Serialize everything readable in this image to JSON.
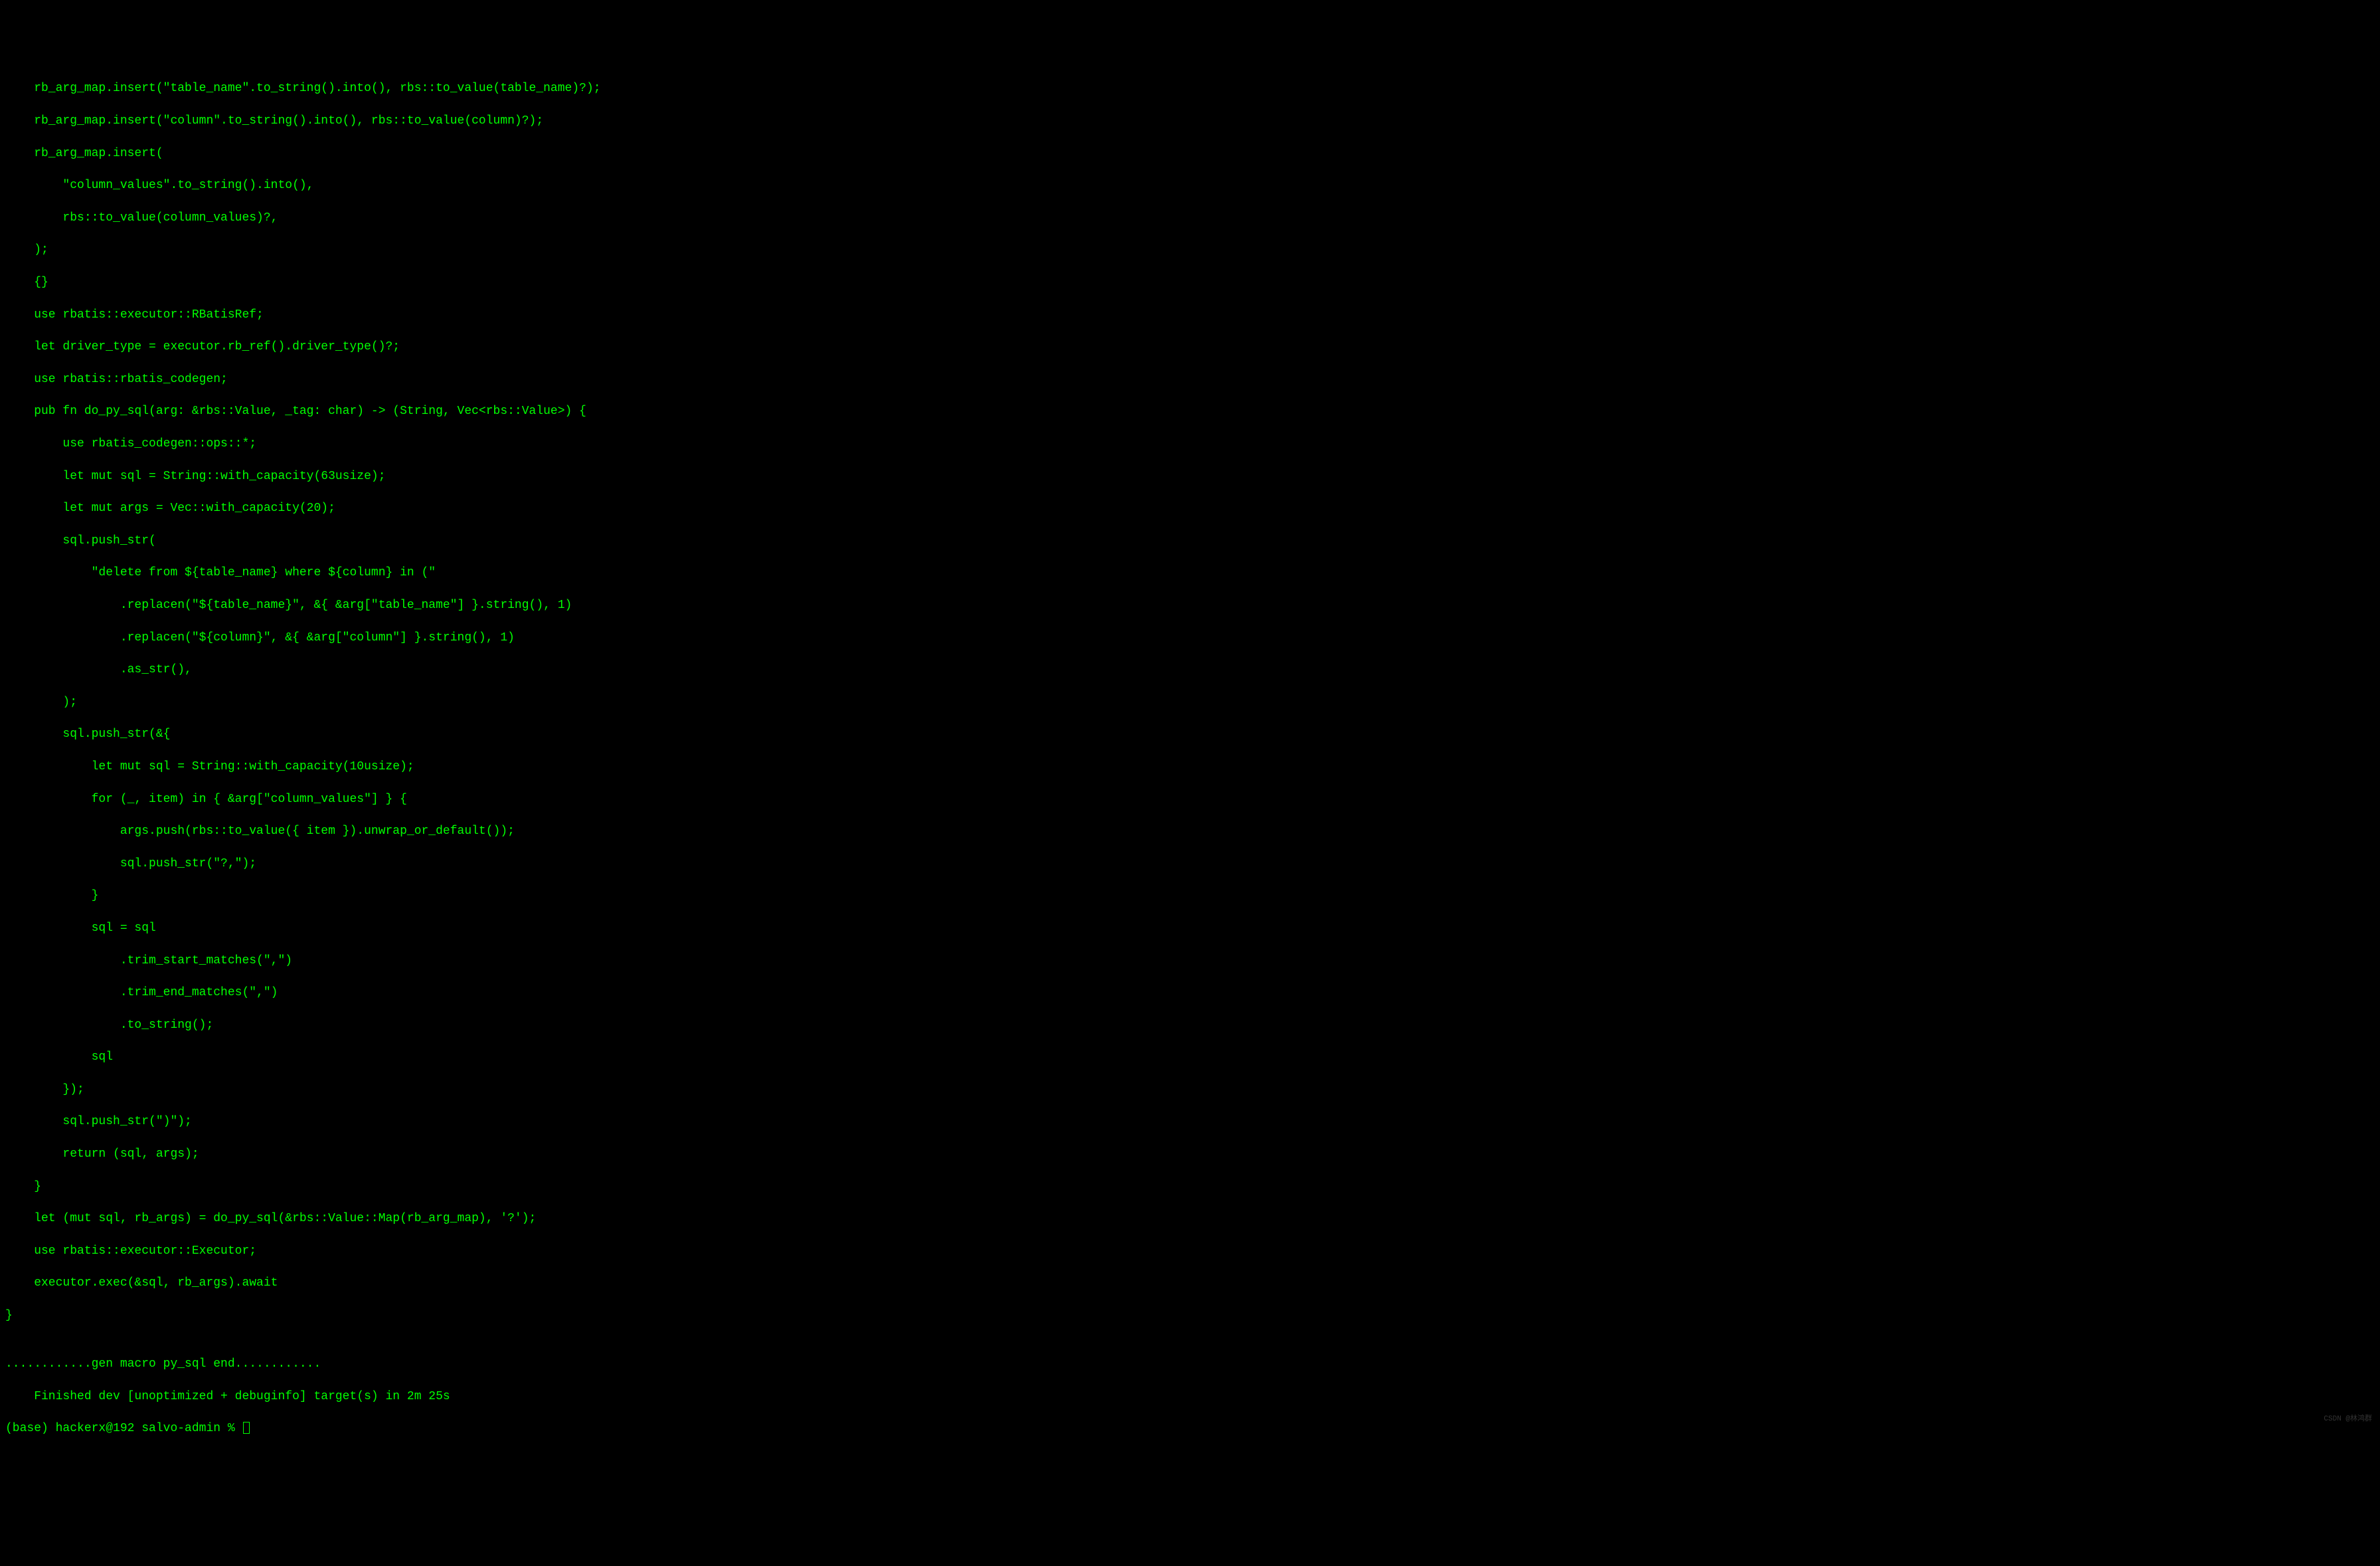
{
  "terminal": {
    "lines": [
      "    rb_arg_map.insert(\"table_name\".to_string().into(), rbs::to_value(table_name)?);",
      "    rb_arg_map.insert(\"column\".to_string().into(), rbs::to_value(column)?);",
      "    rb_arg_map.insert(",
      "        \"column_values\".to_string().into(),",
      "        rbs::to_value(column_values)?,",
      "    );",
      "    {}",
      "    use rbatis::executor::RBatisRef;",
      "    let driver_type = executor.rb_ref().driver_type()?;",
      "    use rbatis::rbatis_codegen;",
      "    pub fn do_py_sql(arg: &rbs::Value, _tag: char) -> (String, Vec<rbs::Value>) {",
      "        use rbatis_codegen::ops::*;",
      "        let mut sql = String::with_capacity(63usize);",
      "        let mut args = Vec::with_capacity(20);",
      "        sql.push_str(",
      "            \"delete from ${table_name} where ${column} in (\"",
      "                .replacen(\"${table_name}\", &{ &arg[\"table_name\"] }.string(), 1)",
      "                .replacen(\"${column}\", &{ &arg[\"column\"] }.string(), 1)",
      "                .as_str(),",
      "        );",
      "        sql.push_str(&{",
      "            let mut sql = String::with_capacity(10usize);",
      "            for (_, item) in { &arg[\"column_values\"] } {",
      "                args.push(rbs::to_value({ item }).unwrap_or_default());",
      "                sql.push_str(\"?,\");",
      "            }",
      "            sql = sql",
      "                .trim_start_matches(\",\")",
      "                .trim_end_matches(\",\")",
      "                .to_string();",
      "            sql",
      "        });",
      "        sql.push_str(\")\");",
      "        return (sql, args);",
      "    }",
      "    let (mut sql, rb_args) = do_py_sql(&rbs::Value::Map(rb_arg_map), '?');",
      "    use rbatis::executor::Executor;",
      "    executor.exec(&sql, rb_args).await",
      "}",
      "",
      "............gen macro py_sql end............",
      "    Finished dev [unoptimized + debuginfo] target(s) in 2m 25s"
    ],
    "prompt": "(base) hackerx@192 salvo-admin % ",
    "watermark": "CSDN @林鸿群"
  }
}
